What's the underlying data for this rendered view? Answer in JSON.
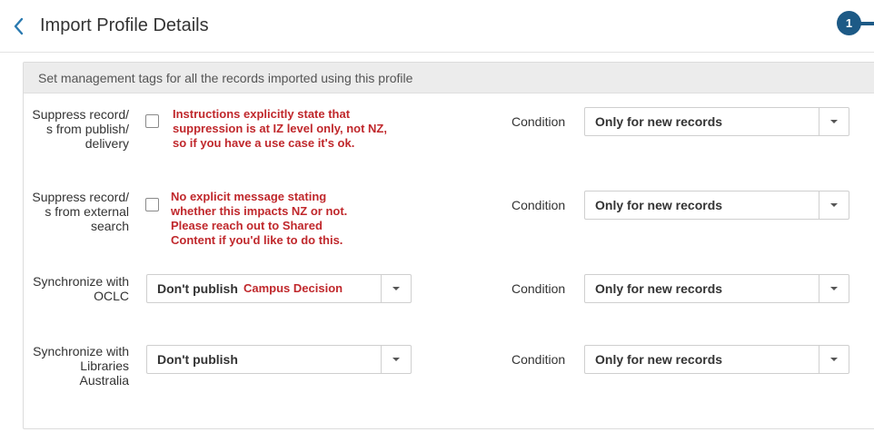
{
  "header": {
    "title": "Import Profile Details",
    "step_number": "1"
  },
  "panel": {
    "heading": "Set management tags for all the records imported using this profile"
  },
  "rows": [
    {
      "label_lines": [
        "Suppress record/",
        "s from publish/",
        "delivery"
      ],
      "checked": false,
      "note_lines": [
        "Instructions explicitly state that",
        "suppression is at IZ level only, not NZ,",
        "so if you have a use case it's ok."
      ],
      "condition_label": "Condition",
      "condition_value": "Only for new records"
    },
    {
      "label_lines": [
        "Suppress record/",
        "s from external",
        "search"
      ],
      "checked": false,
      "note_lines": [
        "No explicit message stating",
        "whether this impacts NZ or not.",
        "Please reach out to Shared",
        "Content if you'd like to do this."
      ],
      "condition_label": "Condition",
      "condition_value": "Only for new records"
    },
    {
      "label_lines": [
        "Synchronize with",
        "OCLC"
      ],
      "select_value": "Don't publish",
      "select_note": "Campus Decision",
      "condition_label": "Condition",
      "condition_value": "Only for new records"
    },
    {
      "label_lines": [
        "Synchronize with",
        "Libraries",
        "Australia"
      ],
      "select_value": "Don't publish",
      "condition_label": "Condition",
      "condition_value": "Only for new records"
    }
  ],
  "colors": {
    "accent": "#1d5a86",
    "back_arrow": "#2a7ab0",
    "note_red": "#c0282c",
    "panel_header_bg": "#ececec"
  },
  "icons": {
    "back": "chevron-left-icon",
    "dropdown": "caret-down-icon"
  }
}
